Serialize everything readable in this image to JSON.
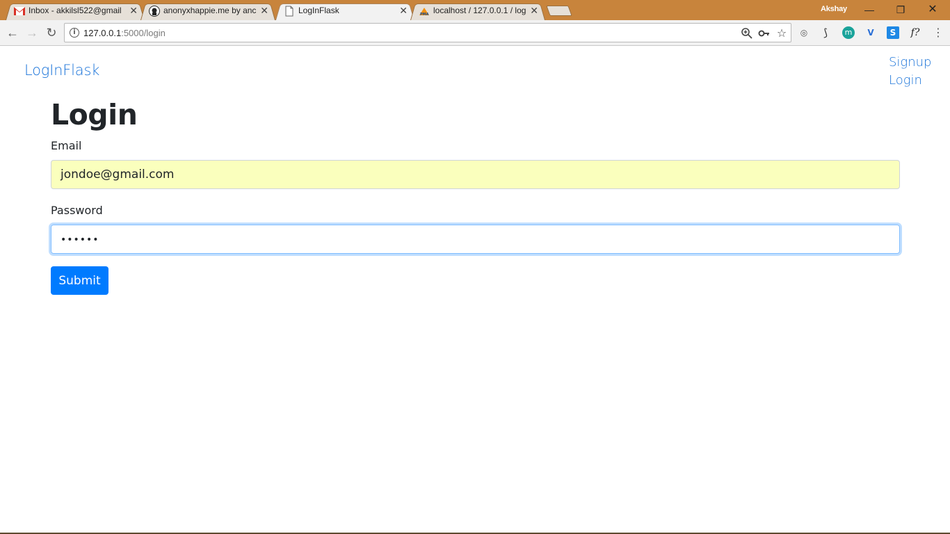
{
  "browser": {
    "tabs": [
      {
        "title": "Inbox - akkilsl522@gmail",
        "favicon": "gmail-icon"
      },
      {
        "title": "anonyxhappie.me by anc",
        "favicon": "github-icon"
      },
      {
        "title": "LogInFlask",
        "favicon": "page-icon"
      },
      {
        "title": "localhost / 127.0.0.1 / log",
        "favicon": "phpmyadmin-icon"
      }
    ],
    "tab_close_glyph": "✕",
    "profile_name": "Akshay",
    "address": {
      "host": "127.0.0.1",
      "path": ":5000/login"
    },
    "extensions": [
      "mirror-icon",
      "hook-icon",
      "m-icon",
      "v-icon",
      "s-icon",
      "f-icon"
    ],
    "colors": {
      "titlebar": "#c8843c",
      "toolbar": "#f2f2f2"
    }
  },
  "page": {
    "brand": "LogInFlask",
    "nav": {
      "signup": "Signup",
      "login": "Login"
    },
    "heading": "Login",
    "email": {
      "label": "Email",
      "value": "jondoe@gmail.com"
    },
    "password": {
      "label": "Password",
      "value": "••••••"
    },
    "submit_label": "Submit",
    "colors": {
      "link": "#1a73d9",
      "button": "#007bff",
      "autofill": "#faffbd"
    }
  }
}
